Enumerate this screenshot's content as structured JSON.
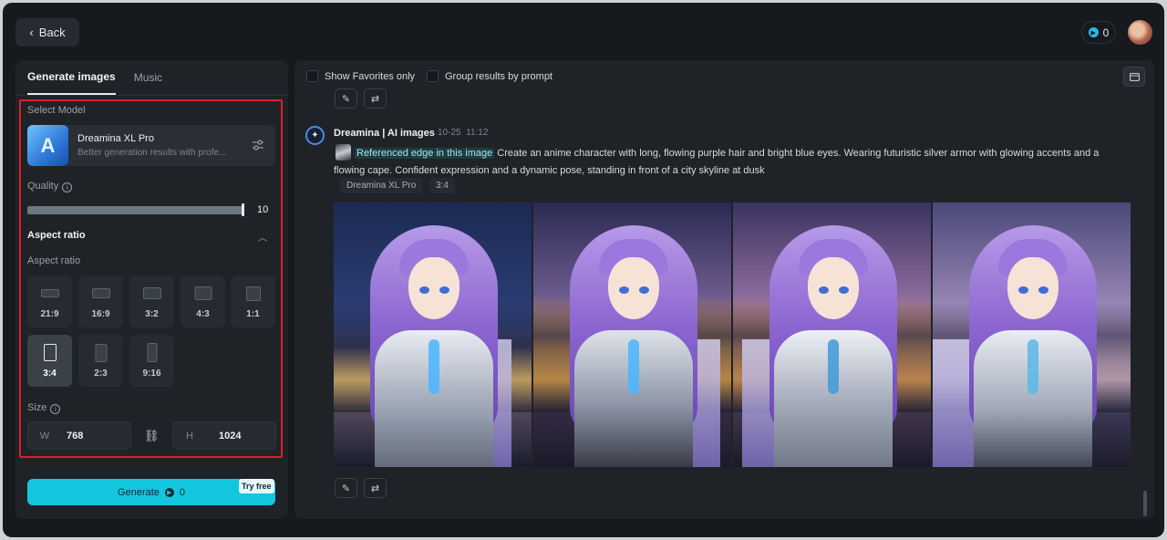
{
  "header": {
    "back_label": "Back",
    "credits": "0"
  },
  "left_panel": {
    "tabs": [
      {
        "label": "Generate images",
        "active": true
      },
      {
        "label": "Music",
        "active": false
      }
    ],
    "select_model_label": "Select Model",
    "model": {
      "name": "Dreamina XL Pro",
      "description": "Better generation results with profe...",
      "thumb_letter": "A"
    },
    "quality": {
      "label": "Quality",
      "value": "10",
      "level_fraction": 1.0
    },
    "aspect_section_title": "Aspect ratio",
    "aspect_label": "Aspect ratio",
    "ratios": [
      {
        "label": "21:9",
        "selected": false
      },
      {
        "label": "16:9",
        "selected": false
      },
      {
        "label": "3:2",
        "selected": false
      },
      {
        "label": "4:3",
        "selected": false
      },
      {
        "label": "1:1",
        "selected": false
      },
      {
        "label": "3:4",
        "selected": true
      },
      {
        "label": "2:3",
        "selected": false
      },
      {
        "label": "9:16",
        "selected": false
      }
    ],
    "size": {
      "label": "Size",
      "w_key": "W",
      "w_value": "768",
      "h_key": "H",
      "h_value": "1024"
    },
    "generate": {
      "label": "Generate",
      "cost": "0",
      "badge": "Try free"
    }
  },
  "right_panel": {
    "show_favorites_label": "Show Favorites only",
    "group_by_prompt_label": "Group results by prompt",
    "message": {
      "author": "Dreamina | AI images",
      "date": "10-25",
      "time": "11:12",
      "ref_label": "Referenced edge in this image",
      "prompt": "Create an anime character with long, flowing purple hair and bright blue eyes. Wearing futuristic silver armor with glowing accents and a flowing cape. Confident expression and a dynamic pose, standing in front of a city skyline at dusk",
      "tags": [
        "Dreamina XL Pro",
        "3:4"
      ]
    }
  },
  "colors": {
    "accent": "#12c7dd",
    "highlight_border": "#e01f26",
    "panel": "#1f2328",
    "background": "#16191d"
  }
}
